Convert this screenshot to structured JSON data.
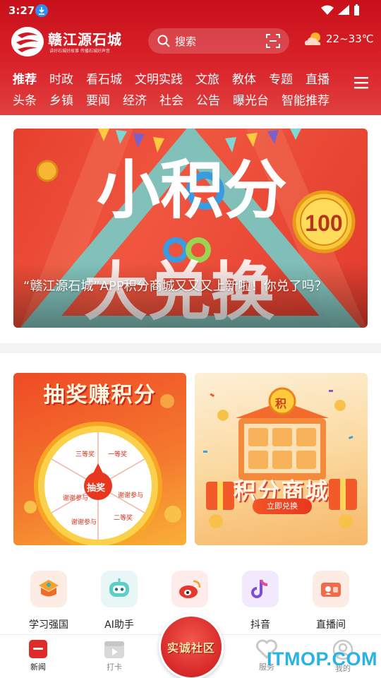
{
  "status_bar": {
    "time": "3:27"
  },
  "brand": {
    "name": "赣江源石城",
    "slogan": "讲好石城好故事 传播石城好声音"
  },
  "search": {
    "placeholder": "搜索"
  },
  "weather": {
    "temperature": "22~33℃"
  },
  "nav": {
    "row1": [
      "推荐",
      "时政",
      "看石城",
      "文明实践",
      "文旅",
      "教体",
      "专题",
      "直播"
    ],
    "row2": [
      "头条",
      "乡镇",
      "要闻",
      "经济",
      "社会",
      "公告",
      "曝光台",
      "智能推荐"
    ],
    "active": "推荐"
  },
  "banner": {
    "art_text": "小积分大兑换",
    "badge_value": "100",
    "caption": "“赣江源石城”APP积分商城又又又上新啦！你兑了吗？"
  },
  "promo": {
    "left": {
      "title": "抽奖赚积分",
      "center": "抽奖",
      "segments": [
        "三等奖",
        "一等奖",
        "谢谢参与",
        "二等奖",
        "谢谢参与",
        "谢谢参与"
      ]
    },
    "right": {
      "emblem": "积",
      "title": "积分商城",
      "button": "立即兑换"
    }
  },
  "tools": [
    "学习强国",
    "AI助手",
    "微博",
    "抖音",
    "直播间"
  ],
  "tabbar": {
    "tabs": [
      "新闻",
      "打卡",
      "服务",
      "我的"
    ],
    "center": "实诚社区",
    "active": "新闻"
  },
  "watermark": "ITMOP.COM",
  "colors": {
    "brand_red": "#d11a22",
    "accent_orange": "#f35428"
  }
}
